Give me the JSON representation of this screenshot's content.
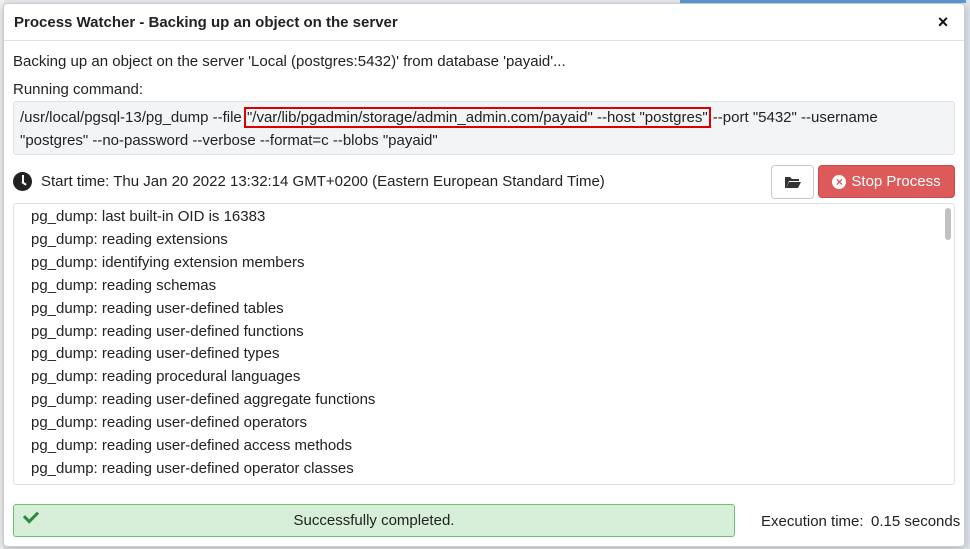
{
  "dialog": {
    "title": "Process Watcher - Backing up an object on the server",
    "close_label": "×"
  },
  "description": "Backing up an object on the server 'Local (postgres:5432)' from database 'payaid'...",
  "running_label": "Running command:",
  "command": {
    "before": "/usr/local/pgsql-13/pg_dump --file ",
    "highlighted": "\"/var/lib/pgadmin/storage/admin_admin.com/payaid\" --host \"postgres\"",
    "after": " --port \"5432\" --username \"postgres\" --no-password --verbose --format=c --blobs \"payaid\""
  },
  "start_time": "Start time: Thu Jan 20 2022 13:32:14 GMT+0200 (Eastern European Standard Time)",
  "buttons": {
    "stop_label": "Stop Process"
  },
  "log_lines": [
    "pg_dump: last built-in OID is 16383",
    "pg_dump: reading extensions",
    "pg_dump: identifying extension members",
    "pg_dump: reading schemas",
    "pg_dump: reading user-defined tables",
    "pg_dump: reading user-defined functions",
    "pg_dump: reading user-defined types",
    "pg_dump: reading procedural languages",
    "pg_dump: reading user-defined aggregate functions",
    "pg_dump: reading user-defined operators",
    "pg_dump: reading user-defined access methods",
    "pg_dump: reading user-defined operator classes"
  ],
  "status": {
    "message": "Successfully completed.",
    "color": "#d7efd9"
  },
  "execution": {
    "label": "Execution time:",
    "value": "0.15 seconds"
  },
  "colors": {
    "stop_button": "#dc5a5a",
    "highlight_outline": "#dd0000"
  },
  "icons": {
    "close": "close-icon",
    "clock": "clock-icon",
    "folder": "folder-open-icon",
    "stop": "stop-circle-icon",
    "check": "check-icon"
  }
}
